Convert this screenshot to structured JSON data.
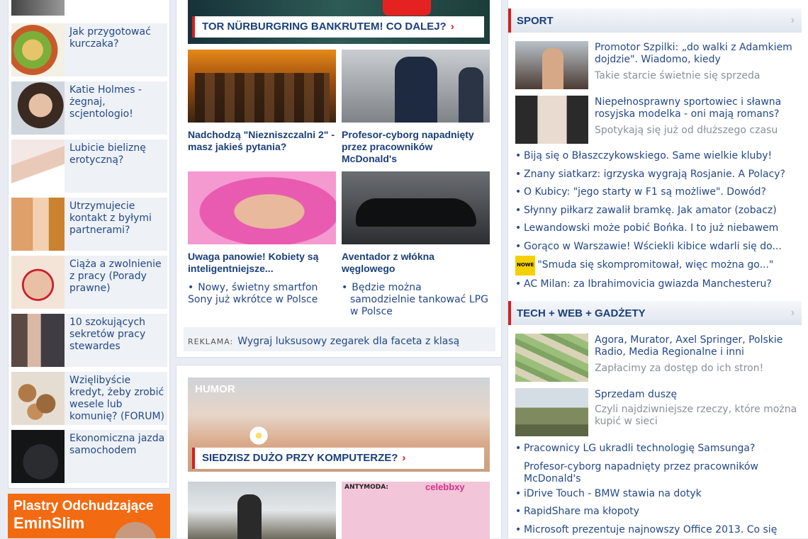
{
  "left_items": [
    {
      "label": "Jak przygotować kurczaka?",
      "icon": "food-photo"
    },
    {
      "label": "Katie Holmes - żegnaj, scjentologio!",
      "icon": "celebrity-photo"
    },
    {
      "label": "Lubicie bieliznę erotyczną?",
      "icon": "lingerie-photo"
    },
    {
      "label": "Utrzymujecie kontakt z byłymi partnerami?",
      "icon": "couple-photo"
    },
    {
      "label": "Ciąża a zwolnienie z pracy (Porady prawne)",
      "icon": "pregnancy-photo"
    },
    {
      "label": "10 szokujących sekretów pracy stewardes",
      "icon": "stewardess-photo"
    },
    {
      "label": "Wzięlibyście kredyt, żeby zrobić wesele lub komunię? (FORUM)",
      "icon": "coins-photo"
    },
    {
      "label": "Ekonomiczna jazda samochodem",
      "icon": "fuel-gauge-photo"
    }
  ],
  "left_ad": {
    "line1": "Plastry Odchudzające",
    "line2": "EminSlim"
  },
  "center": {
    "top_banner_caption": "TOR NÜRBURGRING BANKRUTEM! CO DALEJ?",
    "tiles": [
      {
        "caption": "Nadchodzą \"Niezniszczalni 2\" - masz jakieś pytania?"
      },
      {
        "caption": "Profesor-cyborg napadnięty przez pracowników McDonald's"
      },
      {
        "caption": "Uwaga panowie! Kobiety są inteligentniejsze...",
        "sub": "Nowy, świetny smartfon Sony już wkrótce w Polsce"
      },
      {
        "caption": "Aventador z włókna węglowego",
        "sub": "Będzie można samodzielnie tankować LPG w Polsce"
      }
    ],
    "reklama_label": "REKLAMA:",
    "reklama_text": "Wygraj luksusowy zegarek dla faceta z klasą",
    "humor_label": "HUMOR",
    "humor_caption": "SIEDZISZ DUŻO PRZY KOMPUTERZE?",
    "antymoda_label": "ANTYMODA:",
    "antymoda_brand": "celebbxy"
  },
  "right": {
    "sport": {
      "title": "SPORT",
      "features": [
        {
          "title": "Promotor Szpilki: „do walki z Adamkiem dojdzie\". Wiadomo, kiedy",
          "sub": "Takie starcie świetnie się sprzeda"
        },
        {
          "title": "Niepełnosprawny sportowiec i sławna rosyjska modelka - oni mają romans?",
          "sub": "Spotykają się już od dłuższego czasu"
        }
      ],
      "links": [
        "Biją się o Błaszczykowskiego. Same wielkie kluby!",
        "Znany siatkarz: igrzyska wygrają Rosjanie. A Polacy?",
        "O Kubicy: \"jego starty w F1 są możliwe\". Dowód?",
        "Słynny piłkarz zawalił bramkę. Jak amator (zobacz)",
        "Lewandowski może pobić Bońka. I to już niebawem",
        "Gorąco w Warszawie! Wściekli kibice wdarli się do...",
        "\"Smuda się skompromitował, więc można go...\"",
        "AC Milan: za Ibrahimovicia gwiazda Manchesteru?"
      ],
      "badge": "NOWE"
    },
    "tech": {
      "title": "TECH + WEB + GADŻETY",
      "features": [
        {
          "title": "Agora, Murator, Axel Springer, Polskie Radio, Media Regionalne i inni",
          "sub": "Zapłacimy za dostęp do ich stron!"
        },
        {
          "title": "Sprzedam duszę",
          "sub": "Czyli najdziwniejsze rzeczy, które można kupić w sieci"
        }
      ],
      "links": [
        "Pracownicy LG ukradli technologię Samsunga?",
        "Profesor-cyborg napadnięty przez pracowników McDonald's",
        "iDrive Touch - BMW stawia na dotyk",
        "RapidShare ma kłopoty",
        "Microsoft prezentuje najnowszy Office 2013. Co się"
      ]
    }
  },
  "colors": {
    "accent": "#d91e1e",
    "link": "#24488a",
    "ad_orange": "#f26a12"
  }
}
